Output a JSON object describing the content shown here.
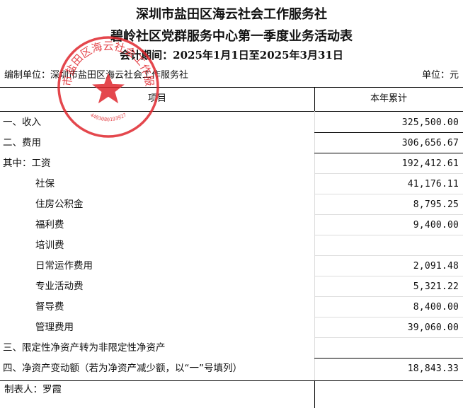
{
  "header": {
    "org_title": "深圳市盐田区海云社会工作服务社",
    "report_title": "碧岭社区党群服务中心第一季度业务活动表",
    "period": "会计期间：2025年1月1日至2025年3月31日"
  },
  "meta": {
    "compiler": "编制单位：深圳市盐田区海云社会工作服务社",
    "unit": "单位：元"
  },
  "columns": {
    "item": "项目",
    "ytd": "本年累计"
  },
  "rows": [
    {
      "label": "一、收入",
      "value": "325,500.00",
      "indent": 0
    },
    {
      "label": "二、费用",
      "value": "306,656.67",
      "indent": 0
    },
    {
      "label": "其中：工资",
      "value": "192,412.61",
      "indent": 0
    },
    {
      "label": "社保",
      "value": "41,176.11",
      "indent": 1
    },
    {
      "label": "住房公积金",
      "value": "8,795.25",
      "indent": 1
    },
    {
      "label": "福利费",
      "value": "9,400.00",
      "indent": 1
    },
    {
      "label": "培训费",
      "value": "",
      "indent": 1
    },
    {
      "label": "日常运作费用",
      "value": "2,091.48",
      "indent": 1
    },
    {
      "label": "专业活动费",
      "value": "5,321.22",
      "indent": 1
    },
    {
      "label": "督导费",
      "value": "8,400.00",
      "indent": 1
    },
    {
      "label": "管理费用",
      "value": "39,060.00",
      "indent": 1
    },
    {
      "label": "三、限定性净资产转为非限定性净资产",
      "value": "",
      "indent": 0
    },
    {
      "label": "四、净资产变动额（若为净资产减少额，以“一”号填列）",
      "value": "18,843.33",
      "indent": 0
    }
  ],
  "footer": {
    "preparer": "制表人：罗霞"
  },
  "seal": {
    "text": "深圳市盐田区海云社会工作服务社",
    "code": "4403080193927",
    "color": "#e0282e"
  }
}
